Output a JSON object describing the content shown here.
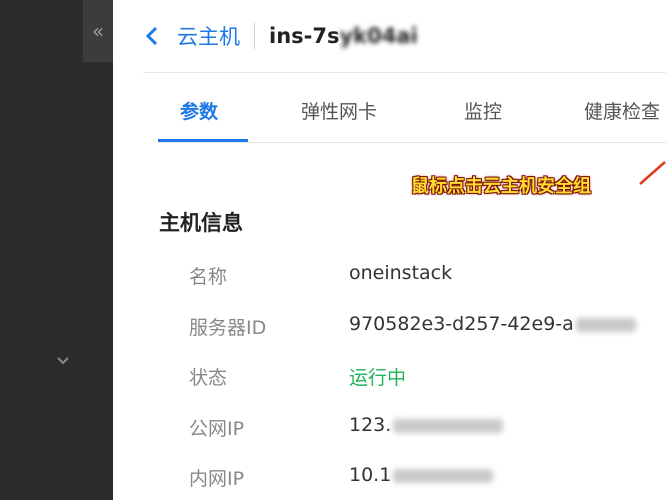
{
  "sidebar": {
    "collapse_glyph": "«",
    "chevron_icon": "chevron-down-icon"
  },
  "header": {
    "back_icon": "chevron-left-icon",
    "breadcrumb": "云主机",
    "title_prefix": "ins-7s",
    "title_blurred": "yk04ai"
  },
  "tabs": [
    {
      "label": "参数",
      "active": true
    },
    {
      "label": "弹性网卡",
      "active": false
    },
    {
      "label": "监控",
      "active": false
    },
    {
      "label": "健康检查",
      "active": false
    }
  ],
  "annotation": {
    "text": "鼠标点击云主机安全组",
    "color": "#ffdd33"
  },
  "section": {
    "title": "主机信息"
  },
  "info": {
    "name": {
      "label": "名称",
      "value": "oneinstack"
    },
    "server_id": {
      "label": "服务器ID",
      "value": "970582e3-d257-42e9-a"
    },
    "status": {
      "label": "状态",
      "value": "运行中"
    },
    "public_ip": {
      "label": "公网IP",
      "value": "123."
    },
    "private_ip": {
      "label": "内网IP",
      "value": "10.1"
    }
  },
  "colors": {
    "accent": "#1e7ae6",
    "status_running": "#1fb35a",
    "sidebar_bg": "#2b2b2b"
  }
}
